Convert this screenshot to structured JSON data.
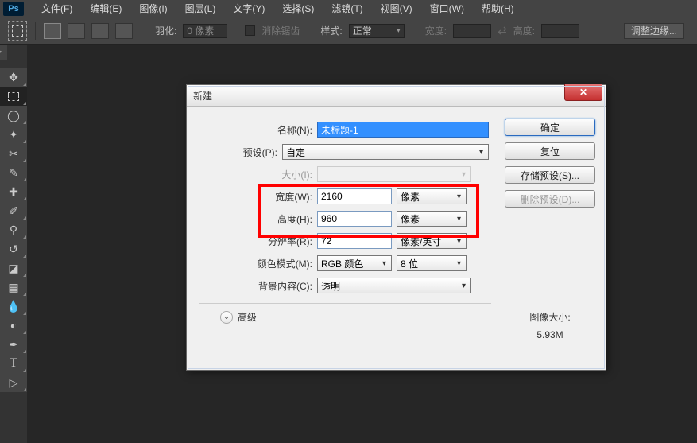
{
  "app": {
    "logo": "Ps"
  },
  "menu": {
    "file": "文件(F)",
    "edit": "编辑(E)",
    "image": "图像(I)",
    "layer": "图层(L)",
    "type": "文字(Y)",
    "select": "选择(S)",
    "filter": "滤镜(T)",
    "view": "视图(V)",
    "window": "窗口(W)",
    "help": "帮助(H)"
  },
  "opt": {
    "feather_label": "羽化:",
    "feather_value": "0 像素",
    "antialias": "消除锯齿",
    "style_label": "样式:",
    "style_value": "正常",
    "width_label": "宽度:",
    "height_label": "高度:",
    "refine": "调整边缘..."
  },
  "dlg": {
    "title": "新建",
    "name_label": "名称(N):",
    "name_value": "未标题-1",
    "preset_label": "预设(P):",
    "preset_value": "自定",
    "size_label": "大小(I):",
    "width_label": "宽度(W):",
    "width_value": "2160",
    "width_unit": "像素",
    "height_label": "高度(H):",
    "height_value": "960",
    "height_unit": "像素",
    "res_label": "分辨率(R):",
    "res_value": "72",
    "res_unit": "像素/英寸",
    "mode_label": "颜色模式(M):",
    "mode_value": "RGB 颜色",
    "depth_value": "8 位",
    "bg_label": "背景内容(C):",
    "bg_value": "透明",
    "advanced": "高级",
    "ok": "确定",
    "reset": "复位",
    "save_preset": "存储预设(S)...",
    "del_preset": "删除预设(D)...",
    "filesize_label": "图像大小:",
    "filesize_value": "5.93M"
  }
}
